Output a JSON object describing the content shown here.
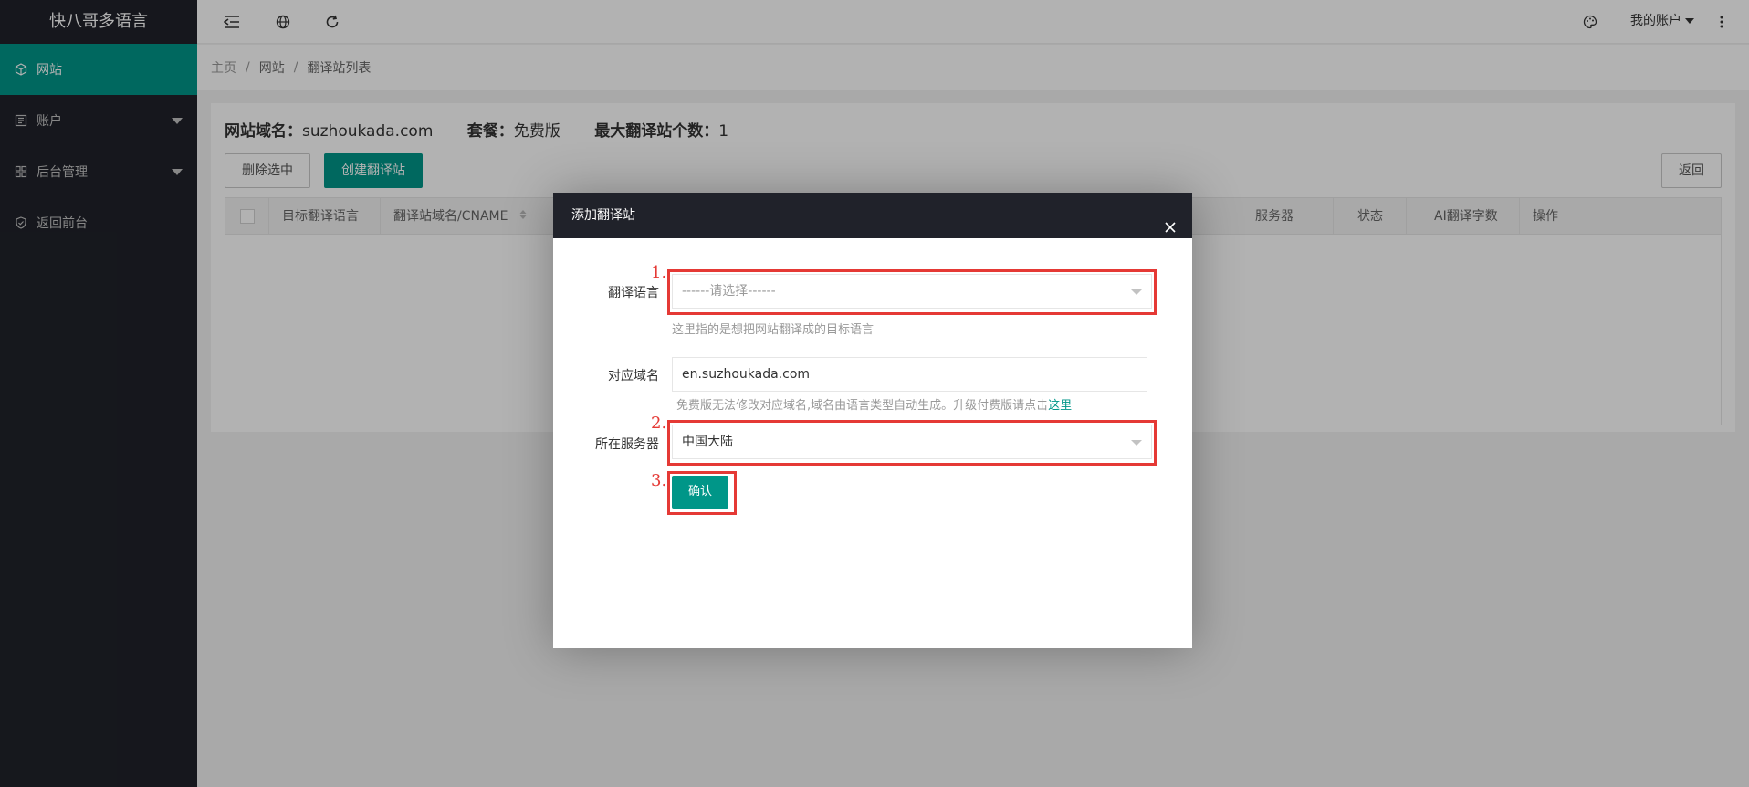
{
  "sidebar": {
    "logo": "快八哥多语言",
    "items": [
      {
        "label": "网站",
        "icon": "cube-icon",
        "active": true
      },
      {
        "label": "账户",
        "icon": "book-icon",
        "active": false,
        "expandable": true
      },
      {
        "label": "后台管理",
        "icon": "apps-icon",
        "active": false,
        "expandable": true
      },
      {
        "label": "返回前台",
        "icon": "shield-icon",
        "active": false
      }
    ]
  },
  "header": {
    "icons": [
      "menu-fold-icon",
      "globe-icon",
      "refresh-icon"
    ],
    "theme_icon": "palette-icon",
    "account_label": "我的账户",
    "more_icon": "more-vertical-icon"
  },
  "breadcrumb": [
    "主页",
    "网站",
    "翻译站列表"
  ],
  "site_info": {
    "domain_label": "网站域名：",
    "domain_value": "suzhoukada.com",
    "plan_label": "套餐：",
    "plan_value": "免费版",
    "max_label": "最大翻译站个数：",
    "max_value": "1"
  },
  "toolbar": {
    "delete_label": "删除选中",
    "create_label": "创建翻译站",
    "back_label": "返回"
  },
  "table": {
    "columns": [
      "目标翻译语言",
      "翻译站域名/CNAME",
      "服务器",
      "状态",
      "AI翻译字数",
      "操作"
    ]
  },
  "modal": {
    "title": "添加翻译站",
    "language_label": "翻译语言",
    "language_placeholder": "------请选择------",
    "language_hint": "这里指的是想把网站翻译成的目标语言",
    "domain_label": "对应域名",
    "domain_value": "en.suzhoukada.com",
    "domain_hint": "免费版无法修改对应域名,域名由语言类型自动生成。升级付费版请点击",
    "domain_hint_link": "这里",
    "server_label": "所在服务器",
    "server_value": "中国大陆",
    "confirm_label": "确认"
  },
  "annotations": [
    "1.",
    "2.",
    "3."
  ],
  "colors": {
    "accent": "#009688",
    "sidebar_bg": "#20222a",
    "annotation_red": "#e53935"
  }
}
